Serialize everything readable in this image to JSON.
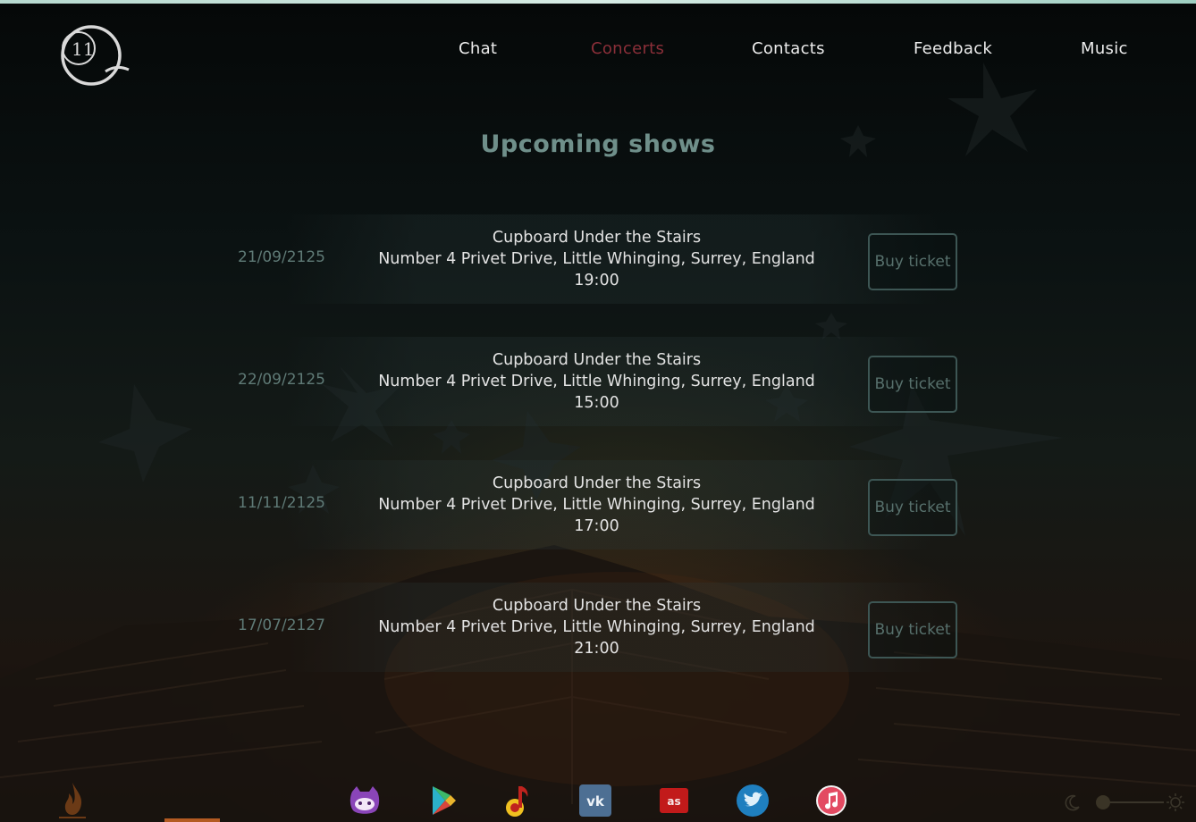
{
  "nav": {
    "items": [
      {
        "label": "Chat",
        "active": false
      },
      {
        "label": "Concerts",
        "active": true
      },
      {
        "label": "Contacts",
        "active": false
      },
      {
        "label": "Feedback",
        "active": false
      },
      {
        "label": "Music",
        "active": false
      }
    ]
  },
  "page": {
    "title": "Upcoming shows"
  },
  "shows": [
    {
      "date": "21/09/2125",
      "venue": "Cupboard Under the Stairs",
      "address": "Number 4 Privet Drive, Little Whinging, Surrey, England",
      "time": "19:00",
      "button": "Buy ticket"
    },
    {
      "date": "22/09/2125",
      "venue": "Cupboard Under the Stairs",
      "address": "Number 4 Privet Drive, Little Whinging, Surrey, England",
      "time": "15:00",
      "button": "Buy ticket"
    },
    {
      "date": "11/11/2125",
      "venue": "Cupboard Under the Stairs",
      "address": "Number 4 Privet Drive, Little Whinging, Surrey, England",
      "time": "17:00",
      "button": "Buy ticket"
    },
    {
      "date": "17/07/2127",
      "venue": "Cupboard Under the Stairs",
      "address": "Number 4 Privet Drive, Little Whinging, Surrey, England",
      "time": "21:00",
      "button": "Buy ticket"
    }
  ],
  "footer": {
    "social": [
      "github-icon",
      "google-play-icon",
      "yandex-music-icon",
      "vk-icon",
      "lastfm-icon",
      "twitter-icon",
      "apple-music-icon"
    ],
    "theme_slider": 0.0
  },
  "colors": {
    "active_nav": "#8b2f39",
    "title": "#6f8f8a",
    "button_border": "#3d5654"
  }
}
